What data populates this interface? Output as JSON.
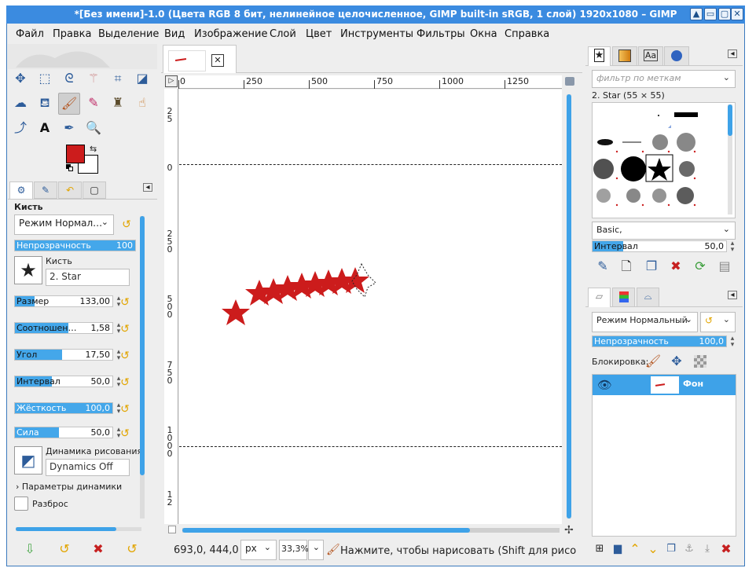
{
  "window": {
    "title": "*[Без имени]-1.0 (Цвета RGB 8 бит, нелинейное целочисленное, GIMP built-in sRGB, 1 слой) 1920x1080 – GIMP",
    "controls": [
      "▲",
      "▭",
      "▢",
      "✕"
    ]
  },
  "menu": [
    "Файл",
    "Правка",
    "Выделение",
    "Вид",
    "Изображение",
    "Слой",
    "Цвет",
    "Инструменты",
    "Фильтры",
    "Окна",
    "Справка"
  ],
  "toolbox": {
    "tools_row1": [
      "move-tool",
      "rect-select-tool",
      "lasso-tool",
      "fuzzy-select-tool",
      "crop-tool",
      "transform-tool"
    ],
    "tools_row2": [
      "warp-tool",
      "bucket-fill-tool",
      "paintbrush-tool",
      "eraser-tool",
      "clone-tool",
      "smudge-tool"
    ],
    "tools_row3": [
      "paths-tool",
      "text-tool",
      "color-picker-tool",
      "zoom-tool"
    ],
    "fg_color": "#cc1c1c",
    "bg_color": "#ffffff"
  },
  "tool_options": {
    "heading": "Кисть",
    "mode": "Режим Нормал…",
    "opacity_label": "Непрозрачность",
    "opacity_value": "100",
    "brush_label": "Кисть",
    "brush_name": "2. Star",
    "sliders": [
      {
        "label": "Размер",
        "value": "133,00",
        "fill": 0.2
      },
      {
        "label": "Соотношен…",
        "value": "1,58",
        "fill": 0.55
      },
      {
        "label": "Угол",
        "value": "17,50",
        "fill": 0.48
      },
      {
        "label": "Интервал",
        "value": "50,0",
        "fill": 0.38
      },
      {
        "label": "Жёсткость",
        "value": "100,0",
        "fill": 1.0
      },
      {
        "label": "Сила",
        "value": "50,0",
        "fill": 0.45
      }
    ],
    "dynamics_label": "Динамика рисования",
    "dynamics_value": "Dynamics Off",
    "dynamics_params": "Параметры динамики",
    "scatter_label": "Разброс"
  },
  "canvas": {
    "tab_close": "✕",
    "ruler_h": [
      "0",
      "250",
      "500",
      "750",
      "1000",
      "1250"
    ],
    "ruler_v": [
      "2 5",
      "0",
      "2 5 0",
      "5 0 0",
      "7 5 0",
      "1 0 0 0"
    ],
    "coords": "693,0, 444,0",
    "unit": "px",
    "zoom": "33,3%",
    "status": "Нажмите, чтобы нарисовать (Shift для рисов…"
  },
  "brushes_panel": {
    "filter_placeholder": "фильтр по меткам",
    "selected": "2. Star (55 × 55)",
    "category": "Basic,",
    "interval_label": "Интервал",
    "interval_value": "50,0"
  },
  "layers_panel": {
    "mode": "Режим  Нормальный",
    "opacity_label": "Непрозрачность",
    "opacity_value": "100,0",
    "lock_label": "Блокировка:",
    "layer_name": "Фон"
  }
}
